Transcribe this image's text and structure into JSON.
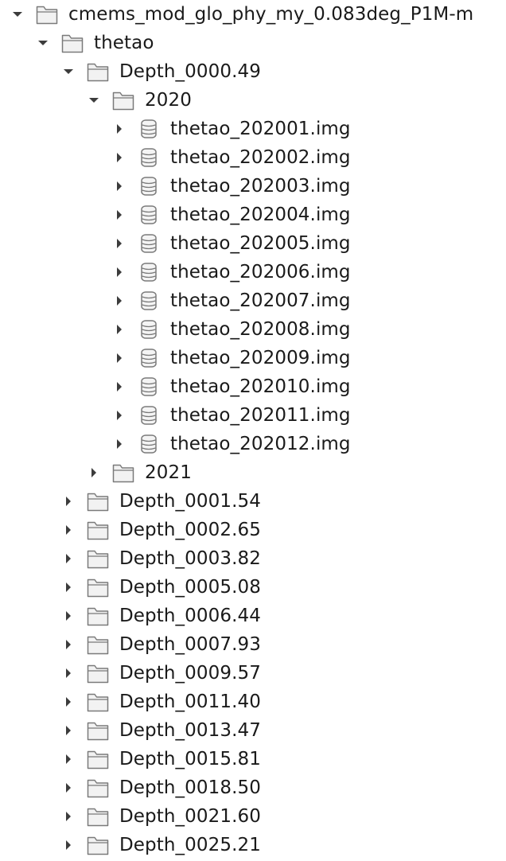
{
  "tree": [
    {
      "label": "cmems_mod_glo_phy_my_0.083deg_P1M-m",
      "kind": "folder",
      "expanded": true,
      "depth": 0
    },
    {
      "label": "thetao",
      "kind": "folder",
      "expanded": true,
      "depth": 1
    },
    {
      "label": "Depth_0000.49",
      "kind": "folder",
      "expanded": true,
      "depth": 2
    },
    {
      "label": "2020",
      "kind": "folder",
      "expanded": true,
      "depth": 3
    },
    {
      "label": "thetao_202001.img",
      "kind": "raster",
      "expanded": false,
      "depth": 4
    },
    {
      "label": "thetao_202002.img",
      "kind": "raster",
      "expanded": false,
      "depth": 4
    },
    {
      "label": "thetao_202003.img",
      "kind": "raster",
      "expanded": false,
      "depth": 4
    },
    {
      "label": "thetao_202004.img",
      "kind": "raster",
      "expanded": false,
      "depth": 4
    },
    {
      "label": "thetao_202005.img",
      "kind": "raster",
      "expanded": false,
      "depth": 4
    },
    {
      "label": "thetao_202006.img",
      "kind": "raster",
      "expanded": false,
      "depth": 4
    },
    {
      "label": "thetao_202007.img",
      "kind": "raster",
      "expanded": false,
      "depth": 4
    },
    {
      "label": "thetao_202008.img",
      "kind": "raster",
      "expanded": false,
      "depth": 4
    },
    {
      "label": "thetao_202009.img",
      "kind": "raster",
      "expanded": false,
      "depth": 4
    },
    {
      "label": "thetao_202010.img",
      "kind": "raster",
      "expanded": false,
      "depth": 4
    },
    {
      "label": "thetao_202011.img",
      "kind": "raster",
      "expanded": false,
      "depth": 4
    },
    {
      "label": "thetao_202012.img",
      "kind": "raster",
      "expanded": false,
      "depth": 4
    },
    {
      "label": "2021",
      "kind": "folder",
      "expanded": false,
      "depth": 3
    },
    {
      "label": "Depth_0001.54",
      "kind": "folder",
      "expanded": false,
      "depth": 2
    },
    {
      "label": "Depth_0002.65",
      "kind": "folder",
      "expanded": false,
      "depth": 2
    },
    {
      "label": "Depth_0003.82",
      "kind": "folder",
      "expanded": false,
      "depth": 2
    },
    {
      "label": "Depth_0005.08",
      "kind": "folder",
      "expanded": false,
      "depth": 2
    },
    {
      "label": "Depth_0006.44",
      "kind": "folder",
      "expanded": false,
      "depth": 2
    },
    {
      "label": "Depth_0007.93",
      "kind": "folder",
      "expanded": false,
      "depth": 2
    },
    {
      "label": "Depth_0009.57",
      "kind": "folder",
      "expanded": false,
      "depth": 2
    },
    {
      "label": "Depth_0011.40",
      "kind": "folder",
      "expanded": false,
      "depth": 2
    },
    {
      "label": "Depth_0013.47",
      "kind": "folder",
      "expanded": false,
      "depth": 2
    },
    {
      "label": "Depth_0015.81",
      "kind": "folder",
      "expanded": false,
      "depth": 2
    },
    {
      "label": "Depth_0018.50",
      "kind": "folder",
      "expanded": false,
      "depth": 2
    },
    {
      "label": "Depth_0021.60",
      "kind": "folder",
      "expanded": false,
      "depth": 2
    },
    {
      "label": "Depth_0025.21",
      "kind": "folder",
      "expanded": false,
      "depth": 2
    }
  ],
  "colors": {
    "text": "#1a1a1a",
    "arrow": "#3c3c3c",
    "icon_stroke": "#7a7a7a",
    "folder_fill": "#f2f2f2",
    "folder_tab_fill": "#e8e8e8",
    "raster_fill": "#f4f4f4"
  },
  "icons": {
    "folder": "folder-icon",
    "raster": "raster-layer-icon",
    "expanded_toggle": "chevron-down-icon",
    "collapsed_toggle": "chevron-right-icon"
  }
}
